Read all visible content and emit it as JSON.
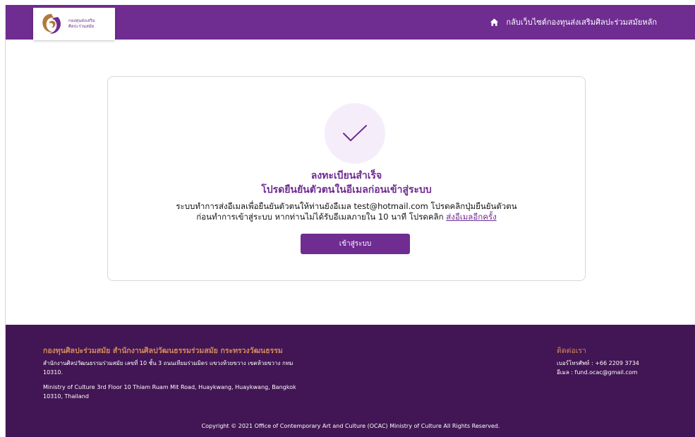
{
  "header": {
    "logo_line1": "กองทุนส่งเสริม",
    "logo_line2": "ศิลปะร่วมสมัย",
    "home_link": "กลับเว็บไซต์กองทุนส่งเสริมศิลปะร่วมสมัยหลัก",
    "home_icon": "home-icon"
  },
  "card": {
    "check_icon": "checkmark-icon",
    "title_line1": "ลงทะเบียนสำเร็จ",
    "title_line2": "โปรดยืนยันตัวตนในอีเมลก่อนเข้าสู่ระบบ",
    "desc_line1": "ระบบทำการส่งอีเมลเพื่อยืนยันตัวตนให้ท่านยังอีเมล test@hotmail.com โปรดคลิกปุ่มยืนยันตัวตน",
    "desc_line2_prefix": "ก่อนทำการเข้าสู่ระบบ หากท่านไม่ได้รับอีเมลภายใน 10 นาที โปรดคลิก",
    "resend_link": "ส่งอีเมลอีกครั้ง",
    "login_button": "เข้าสู่ระบบ"
  },
  "footer": {
    "title": "กองทุนศิลปะร่วมสมัย สำนักงานศิลปวัฒนธรรมร่วมสมัย กระทรวงวัฒนธรรม",
    "address_th": "สำนักงานศิลปวัฒนธรรมร่วมสมัย เลขที่ 10 ชั้น 3 ถนนเทียมร่วมมิตร แขวงห้วยขวาง เขตห้วยขวาง กทม 10310.",
    "address_en": "Ministry of Culture 3rd Floor 10 Thiam Ruam Mit Road, Huaykwang, Huaykwang, Bangkok 10310, Thailand",
    "contact_title": "ติดต่อเรา",
    "phone": "เบอร์โทรศัพท์ : +66 2209 3734",
    "email": "อีเมล : fund.ocac@gmail.com",
    "copyright": "Copyright © 2021 Office of Contemporary Art and Culture (OCAC) Ministry of Culture All Rights Reserved."
  },
  "colors": {
    "brand_purple": "#6f2c91",
    "footer_bg": "#421554",
    "footer_accent": "#d38b59",
    "check_bg": "#f5eefa"
  }
}
